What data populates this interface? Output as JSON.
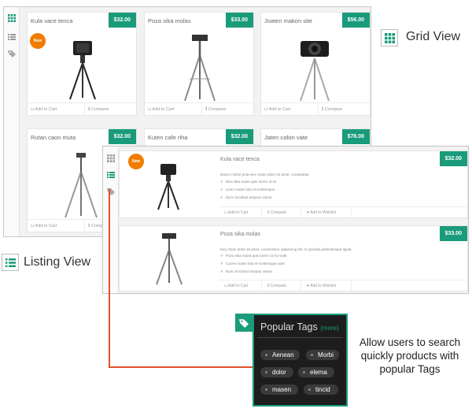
{
  "grid_view": {
    "label": "Grid View",
    "products": [
      {
        "name": "Kula vace tenca",
        "price": "$32.00",
        "badge": "New"
      },
      {
        "name": "Poza sika molas",
        "price": "$33.00"
      },
      {
        "name": "Joaten makon site",
        "price": "$56.00"
      },
      {
        "name": "Rutan caon muta",
        "price": "$32.00"
      },
      {
        "name": "Kuten cafe riha",
        "price": "$32.00"
      },
      {
        "name": "Jaten cafon vate",
        "price": "$78.00"
      }
    ],
    "actions": {
      "add_to_cart": "Add to Cart",
      "compare": "Compare"
    }
  },
  "list_view": {
    "label": "Listing View",
    "items": [
      {
        "name": "Kula vace tenca",
        "price": "$32.00",
        "badge": "New",
        "description": "Bazen mikse pola eien mase dolor sit amet, consedetur",
        "features": [
          "Biza sika mase quis lorem ut mi",
          "Lizen masin lola et scelerisque",
          "Zuric tincidunt tempus varius."
        ]
      },
      {
        "name": "Poza sika molas",
        "price": "$33.00",
        "description": "Kiry mase dolor sit amet, consectetur adipiscing elit. In gravida pellentesque ligula",
        "features": [
          "Poza sika mase quis lorem ut mi mattt",
          "Cazen masin lola et scelerisque ante",
          "Nunc tincidunt tempus varius."
        ]
      }
    ],
    "actions": {
      "add_to_cart": "Add to Cart",
      "compare": "Compare",
      "wishlist": "Add to Wishlist"
    }
  },
  "popular_tags": {
    "title": "Popular Tags",
    "more": "(more)",
    "tags": [
      "Aenean",
      "Morbi",
      "dolor",
      "elema",
      "masen",
      "tincid"
    ]
  },
  "callout": "Allow users to search quickly products with popular Tags",
  "colors": {
    "accent": "#1a9b7b",
    "badge": "#f07c00",
    "connector": "#e0522a",
    "tags_bg": "#1d1d1d"
  }
}
